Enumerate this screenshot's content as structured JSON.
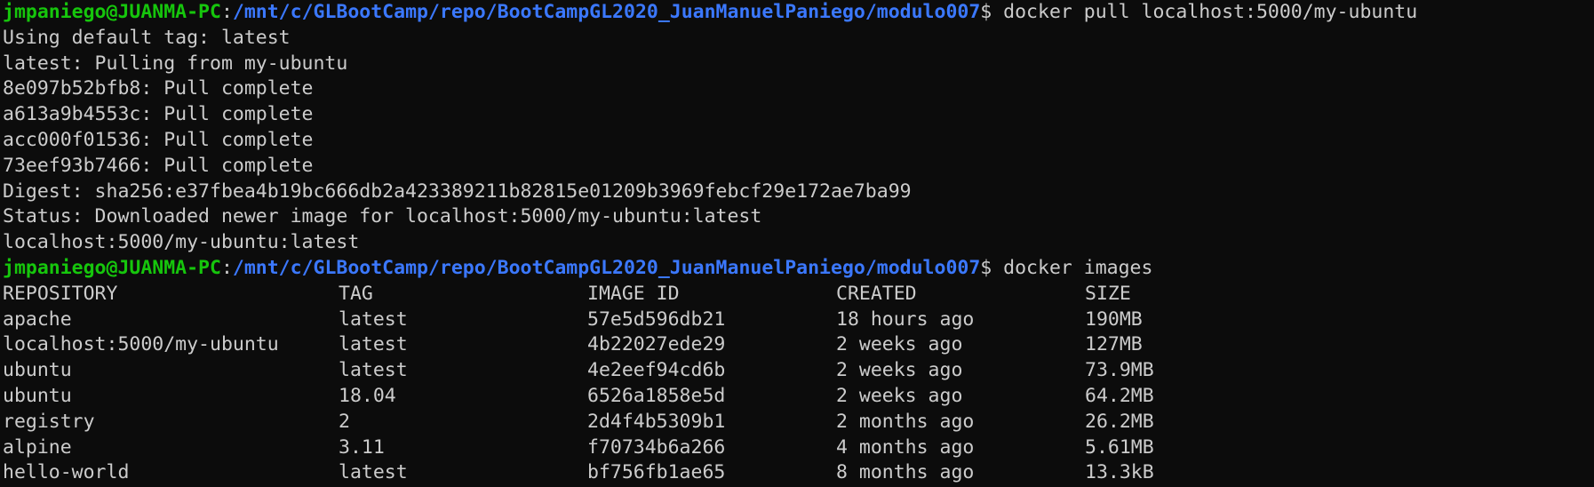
{
  "prompt1": {
    "user": "jmpaniego@JUANMA-PC",
    "sep": ":",
    "path": "/mnt/c/GLBootCamp/repo/BootCampGL2020_JuanManuelPaniego/modulo007",
    "dollar": "$ ",
    "command": "docker pull localhost:5000/my-ubuntu"
  },
  "pull_output": [
    "Using default tag: latest",
    "latest: Pulling from my-ubuntu",
    "8e097b52bfb8: Pull complete",
    "a613a9b4553c: Pull complete",
    "acc000f01536: Pull complete",
    "73eef93b7466: Pull complete",
    "Digest: sha256:e37fbea4b19bc666db2a423389211b82815e01209b3969febcf29e172ae7ba99",
    "Status: Downloaded newer image for localhost:5000/my-ubuntu:latest",
    "localhost:5000/my-ubuntu:latest"
  ],
  "prompt2": {
    "user": "jmpaniego@JUANMA-PC",
    "sep": ":",
    "path": "/mnt/c/GLBootCamp/repo/BootCampGL2020_JuanManuelPaniego/modulo007",
    "dollar": "$ ",
    "command": "docker images"
  },
  "images_table": {
    "headers": [
      "REPOSITORY",
      "TAG",
      "IMAGE ID",
      "CREATED",
      "SIZE"
    ],
    "rows": [
      [
        "apache",
        "latest",
        "57e5d596db21",
        "18 hours ago",
        "190MB"
      ],
      [
        "localhost:5000/my-ubuntu",
        "latest",
        "4b22027ede29",
        "2 weeks ago",
        "127MB"
      ],
      [
        "ubuntu",
        "latest",
        "4e2eef94cd6b",
        "2 weeks ago",
        "73.9MB"
      ],
      [
        "ubuntu",
        "18.04",
        "6526a1858e5d",
        "2 weeks ago",
        "64.2MB"
      ],
      [
        "registry",
        "2",
        "2d4f4b5309b1",
        "2 months ago",
        "26.2MB"
      ],
      [
        "alpine",
        "3.11",
        "f70734b6a266",
        "4 months ago",
        "5.61MB"
      ],
      [
        "hello-world",
        "latest",
        "bf756fb1ae65",
        "8 months ago",
        "13.3kB"
      ]
    ]
  },
  "colors": {
    "background": "#0c0c0c",
    "foreground": "#cccccc",
    "prompt_user": "#16c60c",
    "prompt_path": "#3b78ff"
  }
}
